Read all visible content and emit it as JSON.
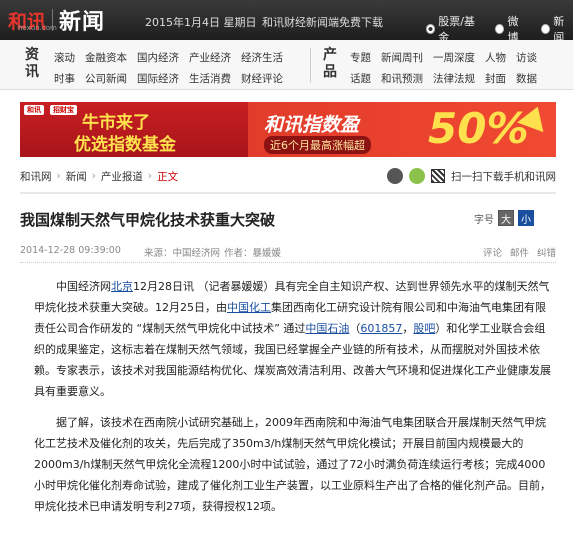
{
  "header": {
    "brand": "和讯",
    "brand_sub": "hexun.com",
    "section": "新闻",
    "date": "2015年1月4日 星期日",
    "promo": "和讯财经新闻端免费下载",
    "search_options": [
      {
        "label": "股票/基金",
        "selected": true
      },
      {
        "label": "微博",
        "selected": false
      },
      {
        "label": "新闻",
        "selected": false
      }
    ]
  },
  "nav": {
    "left_label": "资讯",
    "left_items": [
      "滚动",
      "金融资本",
      "国内经济",
      "产业经济",
      "经济生活",
      "时事",
      "公司新闻",
      "国际经济",
      "生活消费",
      "财经评论"
    ],
    "right_label": "产品",
    "right_items": [
      "专题",
      "新闻周刊",
      "一周深度",
      "人物",
      "访谈",
      "话题",
      "和讯预测",
      "法律法规",
      "封面",
      "数据"
    ]
  },
  "banner": {
    "logos": [
      "和讯",
      "招财宝"
    ],
    "headline_1": "牛市来了",
    "headline_2": "优选指数基金",
    "title": "和讯指数盈",
    "subtitle": "近6个月最高涨幅超",
    "percent": "50%"
  },
  "breadcrumb": {
    "items": [
      "和讯网",
      "新闻",
      "产业报道"
    ],
    "current": "正文",
    "right_text": "扫一扫下载手机和讯网"
  },
  "article": {
    "title": "我国煤制天然气甲烷化技术获重大突破",
    "font_label": "字号",
    "font_large": "大",
    "font_small": "小",
    "datetime": "2014-12-28 09:39:00",
    "source_label": "来源：",
    "source": "中国经济网",
    "author_label": "作者：",
    "author": "暴媛媛",
    "actions": [
      "评论",
      "邮件",
      "纠错"
    ],
    "p1": {
      "t0": "中国经济网",
      "l0": "北京",
      "t1": "12月28日讯 （记者暴媛媛）具有完全自主知识产权、达到世界领先水平的煤制天然气甲烷化技术获重大突破。12月25日，由",
      "l1": "中国化工",
      "t2": "集团西南化工研究设计院有限公司和中海油气电集团有限责任公司合作研发的 “煤制天然气甲烷化中试技术” 通过",
      "l2": "中国石油",
      "t3": "（",
      "l3": "601857",
      "t4": "，",
      "l4": "股吧",
      "t5": "）和化学工业联合会组织的成果鉴定，这标志着在煤制天然气领域，我国已经掌握全产业链的所有技术，从而摆脱对外国技术依赖。专家表示，该技术对我国能源结构优化、煤炭高效清洁利用、改善大气环境和促进煤化工产业健康发展具有重要意义。"
    },
    "p2": "据了解，该技术在西南院小试研究基础上，2009年西南院和中海油气电集团联合开展煤制天然气甲烷化工艺技术及催化剂的攻关，先后完成了350m3/h煤制天然气甲烷化模试；开展目前国内规模最大的2000m3/h煤制天然气甲烷化全流程1200小时中试试验，通过了72小时满负荷连续运行考核；完成4000小时甲烷化催化剂寿命试验，建成了催化剂工业生产装置，以工业原料生产出了合格的催化剂产品。目前，甲烷化技术已申请发明专利27项，获得授权12项。"
  }
}
